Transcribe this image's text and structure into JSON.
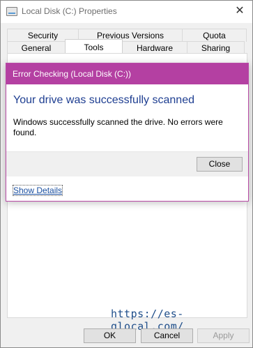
{
  "window": {
    "title": "Local Disk (C:) Properties",
    "close_glyph": "✕"
  },
  "tabs": {
    "row1": [
      "Security",
      "Previous Versions",
      "Quota"
    ],
    "row2": [
      "General",
      "Tools",
      "Hardware",
      "Sharing"
    ],
    "active": "Tools"
  },
  "dialog": {
    "title": "Error Checking (Local Disk (C:))",
    "heading": "Your drive was successfully scanned",
    "message": "Windows successfully scanned the drive. No errors were found.",
    "close_label": "Close",
    "details_link": "Show Details",
    "accent_color": "#b440a2",
    "heading_color": "#1e3e91"
  },
  "watermark": {
    "text": "https://es-glocal.com/"
  },
  "buttons": {
    "ok": "OK",
    "cancel": "Cancel",
    "apply": "Apply"
  },
  "icons": {
    "window": "drive-icon",
    "close": "close-icon"
  }
}
